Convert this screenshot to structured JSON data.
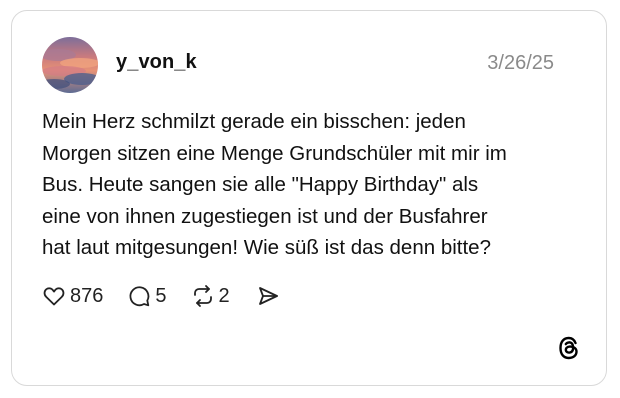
{
  "post": {
    "username": "y_von_k",
    "date": "3/26/25",
    "text_lines": [
      "Mein Herz schmilzt gerade ein bisschen: jeden",
      "Morgen sitzen eine Menge Grundschüler mit mir im",
      "Bus. Heute sangen sie alle \"Happy Birthday\" als",
      "eine von ihnen zugestiegen ist und der Busfahrer",
      "hat laut mitgesungen! Wie süß ist das denn bitte?"
    ],
    "avatar": {
      "icon": "sunset-sky-photo"
    }
  },
  "actions": {
    "likes": {
      "icon": "heart-icon",
      "count": "876"
    },
    "replies": {
      "icon": "comment-icon",
      "count": "5"
    },
    "reposts": {
      "icon": "repost-icon",
      "count": "2"
    },
    "share": {
      "icon": "send-icon"
    }
  },
  "brand": {
    "icon": "threads-logo-icon",
    "color": "#000000"
  },
  "colors": {
    "text": "#111111",
    "muted": "#8a8a8a",
    "border": "#d9d9d9",
    "background": "#ffffff"
  }
}
